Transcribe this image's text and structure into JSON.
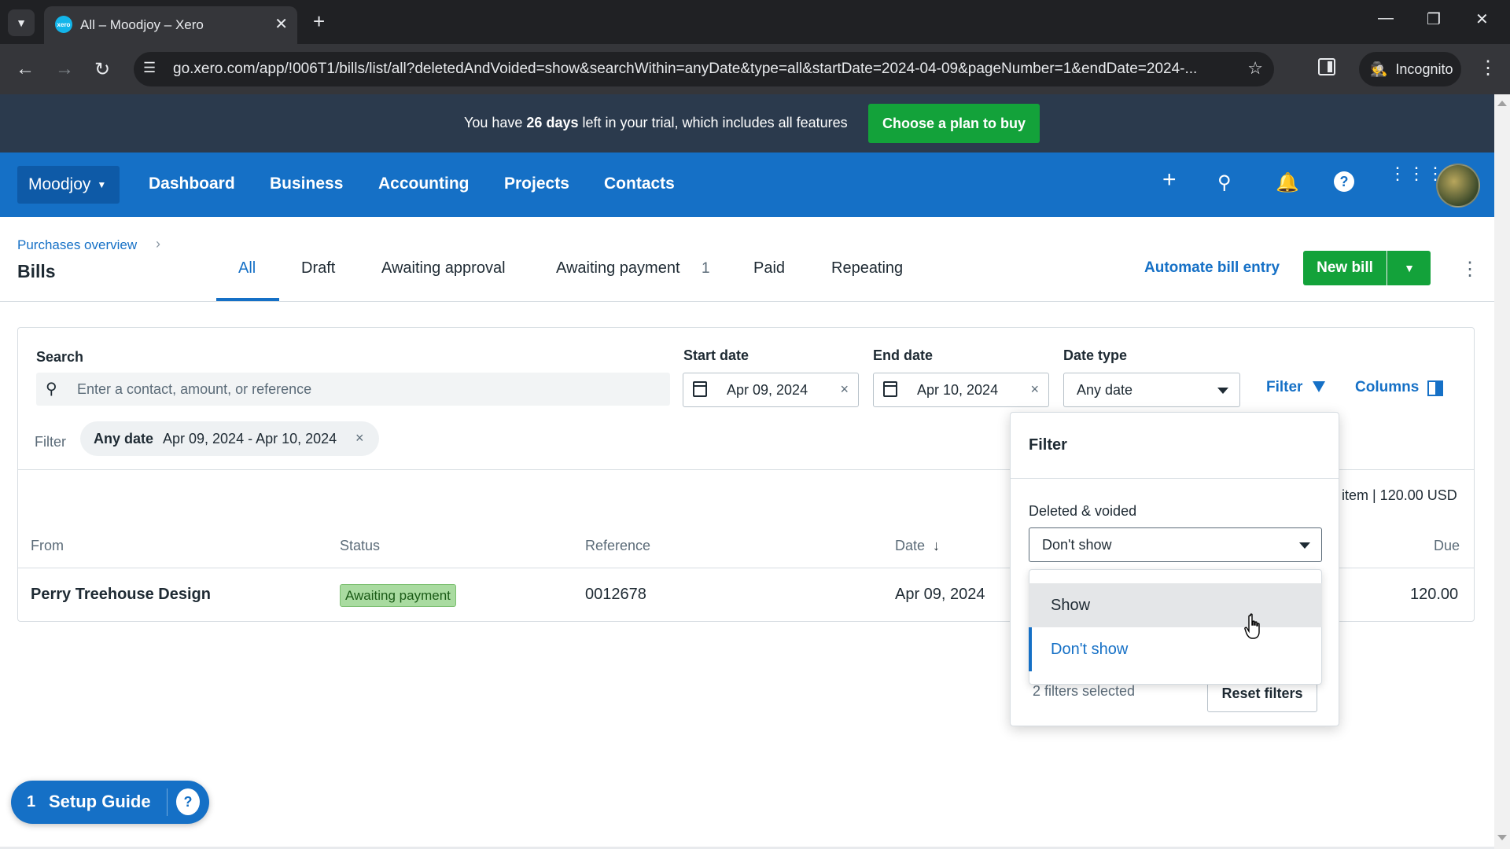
{
  "browser": {
    "tab_title": "All – Moodjoy – Xero",
    "tab_close": "✕",
    "new_tab": "+",
    "url": "go.xero.com/app/!006T1/bills/list/all?deletedAndVoided=show&searchWithin=anyDate&type=all&startDate=2024-04-09&pageNumber=1&endDate=2024-...",
    "incognito_label": "Incognito"
  },
  "trial_banner": {
    "text_before": "You have ",
    "days": "26 days",
    "text_after": " left in your trial, which includes all features",
    "cta": "Choose a plan to buy"
  },
  "header": {
    "org": "Moodjoy",
    "nav": [
      "Dashboard",
      "Business",
      "Accounting",
      "Projects",
      "Contacts"
    ]
  },
  "page": {
    "breadcrumb": "Purchases overview",
    "title": "Bills",
    "tabs": [
      "All",
      "Draft",
      "Awaiting approval",
      "Awaiting payment",
      "Paid",
      "Repeating"
    ],
    "awaiting_payment_count": "1",
    "automate": "Automate bill entry",
    "new_bill": "New bill"
  },
  "filters": {
    "search_label": "Search",
    "search_placeholder": "Enter a contact, amount, or reference",
    "start_date_label": "Start date",
    "start_date": "Apr 09, 2024",
    "end_date_label": "End date",
    "end_date": "Apr 10, 2024",
    "date_type_label": "Date type",
    "date_type": "Any date",
    "filter_link": "Filter",
    "columns_link": "Columns",
    "filter_label": "Filter",
    "chip_key": "Any date",
    "chip_value": "Apr 09, 2024 - Apr 10, 2024",
    "clear": "×"
  },
  "summary": "item | 120.00 USD",
  "table": {
    "headers": {
      "from": "From",
      "status": "Status",
      "reference": "Reference",
      "date": "Date",
      "due": "Due"
    },
    "rows": [
      {
        "from": "Perry Treehouse Design",
        "status": "Awaiting payment",
        "reference": "0012678",
        "date": "Apr 09, 2024",
        "due": "120.00"
      }
    ]
  },
  "filter_popup": {
    "title": "Filter",
    "deleted_voided_label": "Deleted & voided",
    "selected": "Don't show",
    "options": [
      "Show",
      "Don't show"
    ],
    "count": "2 filters selected",
    "reset": "Reset filters"
  },
  "setup_guide": {
    "count": "1",
    "label": "Setup Guide"
  },
  "colors": {
    "xero_blue": "#1570c6",
    "brand_green": "#13a23a",
    "banner_bg": "#2b3a4d"
  }
}
